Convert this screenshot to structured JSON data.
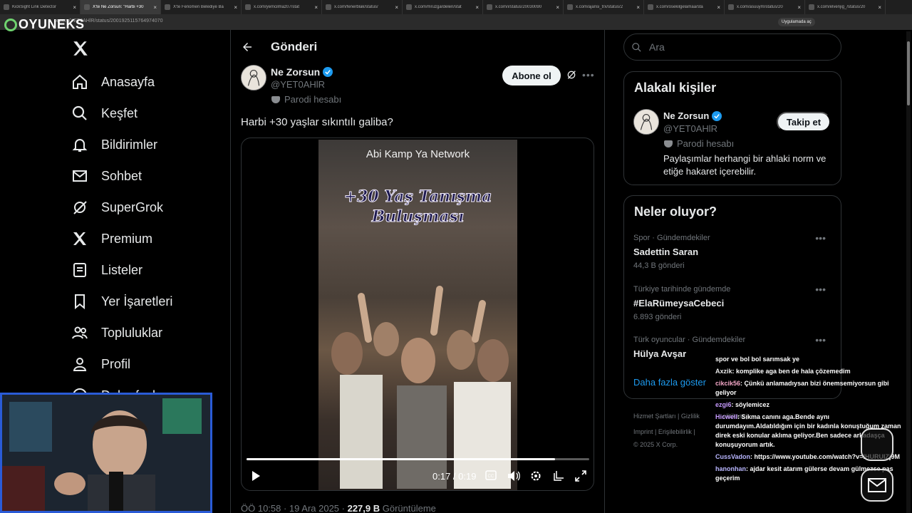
{
  "browser": {
    "tabs": [
      {
        "title": "KickSight Link Detector",
        "active": false
      },
      {
        "title": "X'te Ne Zorsun: \"Harbi +30",
        "active": true
      },
      {
        "title": "X'te Fenomen Belediye Ba",
        "active": false
      },
      {
        "title": "x.com/yemcilmaz07/stat",
        "active": false
      },
      {
        "title": "x.com/fenerblak/status/",
        "active": false
      },
      {
        "title": "x.com/mruzgardelen/stat",
        "active": false
      },
      {
        "title": "x.com/i/status/20030090",
        "active": false
      },
      {
        "title": "x.com/ajansi_trx/status/2",
        "active": false
      },
      {
        "title": "x.com/osekilgelamaa/sta",
        "active": false
      },
      {
        "title": "x.com/asuuym/status/20",
        "active": false
      },
      {
        "title": "x.com/elvenjig_/status/20",
        "active": false
      }
    ],
    "url": "x.com/YET0AHlR/status/2001925115764974070",
    "app_chip": "Uygulamada aç"
  },
  "overlay_logo": "OYUNEKS",
  "nav": {
    "items": [
      {
        "label": "Anasayfa",
        "icon": "home-icon"
      },
      {
        "label": "Keşfet",
        "icon": "search-icon"
      },
      {
        "label": "Bildirimler",
        "icon": "bell-icon"
      },
      {
        "label": "Sohbet",
        "icon": "mail-icon"
      },
      {
        "label": "SuperGrok",
        "icon": "grok-icon"
      },
      {
        "label": "Premium",
        "icon": "x-icon"
      },
      {
        "label": "Listeler",
        "icon": "list-icon"
      },
      {
        "label": "Yer İşaretleri",
        "icon": "bookmark-icon"
      },
      {
        "label": "Topluluklar",
        "icon": "people-icon"
      },
      {
        "label": "Profil",
        "icon": "person-icon"
      },
      {
        "label": "Daha fazla",
        "icon": "more-icon"
      }
    ]
  },
  "post": {
    "header_title": "Gönderi",
    "author_name": "Ne Zorsun",
    "author_handle": "@YET0AHlR",
    "parody_label": "Parodi hesabı",
    "subscribe_label": "Abone ol",
    "text": "Harbi +30 yaşlar sıkıntılı galiba?",
    "video": {
      "caption": "Abi Kamp Ya Network",
      "title_line1": "+30 Yaş Tanışma",
      "title_line2": "Buluşması",
      "time": "0:17 / 0:19",
      "progress": 0.9
    },
    "meta_time": "ÖÖ 10:58 · 19 Ara 2025 · ",
    "views_count": "227,9 B",
    "views_label": " Görüntüleme"
  },
  "sidebar": {
    "search_placeholder": "Ara",
    "related_title": "Alakalı kişiler",
    "related": {
      "name": "Ne Zorsun",
      "handle": "@YET0AHlR",
      "parody": "Parodi hesabı",
      "bio": "Paylaşımlar herhangi bir ahlaki norm ve etiğe hakaret içerebilir.",
      "follow_label": "Takip et"
    },
    "trends_title": "Neler oluyor?",
    "trends": [
      {
        "context": "Spor · Gündemdekiler",
        "name": "Sadettin Saran",
        "count": "44,3 B gönderi"
      },
      {
        "context": "Türkiye tarihinde gündemde",
        "name": "#ElaRümeysaCebeci",
        "count": "6.893 gönderi"
      },
      {
        "context": "Türk oyuncular · Gündemdekiler",
        "name": "Hülya Avşar",
        "count": ""
      }
    ],
    "show_more": "Daha fazla göster",
    "footer_line1": "Hizmet Şartları  |  Gizlilik",
    "footer_line1b": "olitikası  |",
    "footer_line2": "Imprint  |  Erişilebilirlik  |",
    "footer_line3": "© 2025 X Corp."
  },
  "chat": {
    "messages": [
      {
        "user": "",
        "text": "spor ve bol bol sarımsak ye",
        "color": "#ffffff"
      },
      {
        "user": "Axzik",
        "text": ": komplike aga ben de hala çözemedim",
        "color": "#e8e8e8"
      },
      {
        "user": "cikcik56",
        "text": ": Çünkü anlamadıysan bizi önemsemiyorsun gibi geliyor",
        "color": "#f4a7c7"
      },
      {
        "user": "ezgi6",
        "text": ": söylemicez",
        "color": "#c79bff"
      },
      {
        "user": "Hicwell",
        "text": ": Sıkma canını aga.Bende aynı durumdayım.Aldatıldığım için bir kadınla konuştuğum zaman direk eski konular aklıma geliyor.Ben sadece arkadaşça konuşuyorum artık.",
        "color": "#c79bff"
      },
      {
        "user": "CussVadon",
        "text": ": https://www.youtube.com/watch?v=IHURUIZj9M",
        "color": "#b9b6ff"
      },
      {
        "user": "hanonhan",
        "text": ": ajdar kesit atarım gülerse devam gülmezse pas geçerim",
        "color": "#b9b6ff"
      }
    ]
  },
  "colors": {
    "accent": "#1d9bf0",
    "background": "#000000",
    "border": "#2f3336",
    "muted": "#71767b",
    "webcam_border": "#2a5bd7"
  }
}
